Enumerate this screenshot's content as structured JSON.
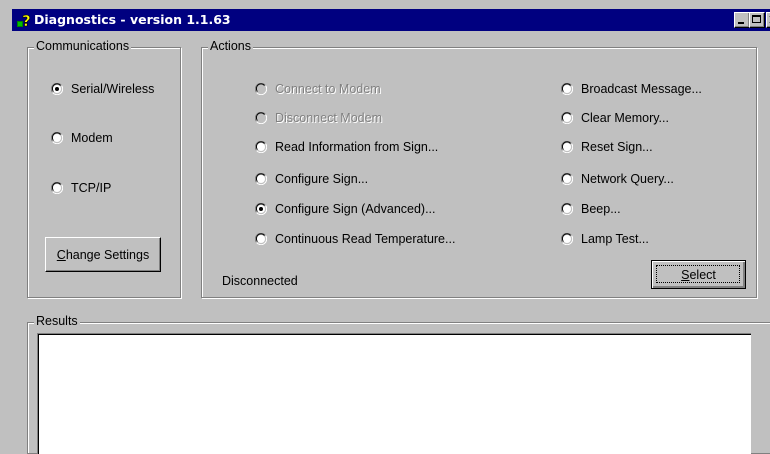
{
  "window": {
    "title": "Diagnostics - version 1.1.63",
    "icon": "question-mark-app-icon"
  },
  "communications": {
    "legend": "Communications",
    "options": [
      {
        "label": "Serial/Wireless",
        "checked": true
      },
      {
        "label": "Modem",
        "checked": false
      },
      {
        "label": "TCP/IP",
        "checked": false
      }
    ],
    "change_settings": {
      "prefix": "",
      "mnemonic": "C",
      "rest": "hange Settings"
    }
  },
  "actions": {
    "legend": "Actions",
    "left_options": [
      {
        "label": "Connect to Modem",
        "checked": false,
        "enabled": false
      },
      {
        "label": "Disconnect Modem",
        "checked": false,
        "enabled": false
      },
      {
        "label": "Read Information from Sign...",
        "checked": false,
        "enabled": true
      },
      {
        "label": "Configure Sign...",
        "checked": false,
        "enabled": true
      },
      {
        "label": "Configure Sign (Advanced)...",
        "checked": true,
        "enabled": true
      },
      {
        "label": "Continuous Read Temperature...",
        "checked": false,
        "enabled": true
      }
    ],
    "right_options": [
      {
        "label": "Broadcast Message...",
        "checked": false,
        "enabled": true
      },
      {
        "label": "Clear Memory...",
        "checked": false,
        "enabled": true
      },
      {
        "label": "Reset Sign...",
        "checked": false,
        "enabled": true
      },
      {
        "label": "Network Query...",
        "checked": false,
        "enabled": true
      },
      {
        "label": "Beep...",
        "checked": false,
        "enabled": true
      },
      {
        "label": "Lamp Test...",
        "checked": false,
        "enabled": true
      }
    ],
    "status": "Disconnected",
    "select": {
      "mnemonic": "S",
      "rest": "elect"
    }
  },
  "results": {
    "legend": "Results",
    "content": ""
  }
}
